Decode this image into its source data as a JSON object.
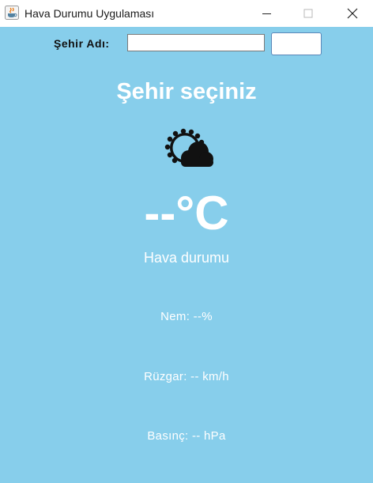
{
  "window": {
    "title": "Hava Durumu Uygulaması",
    "icon": "java-cup-icon",
    "controls": [
      "minimize-icon",
      "maximize-icon",
      "close-icon"
    ]
  },
  "search": {
    "label": "Şehir Adı:",
    "input_value": "",
    "button_label": ""
  },
  "weather": {
    "city": "Şehir seçiniz",
    "icon": "partly-cloudy-icon",
    "temperature": "--°C",
    "description": "Hava durumu",
    "humidity": "Nem: --%",
    "wind": "Rüzgar: -- km/h",
    "pressure": "Basınç: -- hPa"
  },
  "colors": {
    "background": "#87ceeb",
    "text": "#ffffff",
    "titlebar": "#ffffff"
  }
}
